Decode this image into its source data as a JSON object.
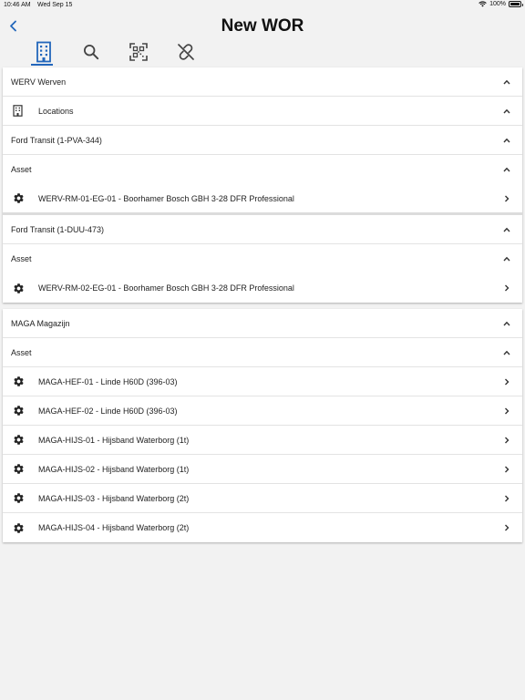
{
  "status": {
    "time": "10:46 AM",
    "date": "Wed Sep 15",
    "battery": "100%"
  },
  "header": {
    "title": "New WOR"
  },
  "toolbar": {
    "tabs": [
      "building-icon",
      "search-icon",
      "qr-scan-icon",
      "unlink-icon"
    ],
    "active_index": 0
  },
  "colors": {
    "accent": "#2266bb",
    "background": "#f2f2f2"
  },
  "sections": [
    {
      "rows": [
        {
          "type": "header",
          "label": "WERV Werven",
          "chevron": "up"
        },
        {
          "type": "item",
          "icon": "building-icon",
          "label": "Locations",
          "chevron": "up"
        },
        {
          "type": "header",
          "label": "Ford Transit (1-PVA-344)",
          "chevron": "up"
        },
        {
          "type": "header",
          "label": "Asset",
          "chevron": "up"
        },
        {
          "type": "item",
          "icon": "gear-icon",
          "label": "WERV-RM-01-EG-01 - Boorhamer Bosch GBH 3-28 DFR Professional",
          "chevron": "right"
        },
        {
          "type": "header",
          "label": "Ford Transit (1-DUU-473)",
          "chevron": "up"
        },
        {
          "type": "header",
          "label": "Asset",
          "chevron": "up"
        },
        {
          "type": "item",
          "icon": "gear-icon",
          "label": "WERV-RM-02-EG-01 - Boorhamer Bosch GBH 3-28 DFR Professional",
          "chevron": "right"
        }
      ]
    },
    {
      "rows": [
        {
          "type": "header",
          "label": "MAGA Magazijn",
          "chevron": "up"
        },
        {
          "type": "header",
          "label": "Asset",
          "chevron": "up"
        },
        {
          "type": "item",
          "icon": "gear-icon",
          "label": "MAGA-HEF-01 - Linde H60D (396-03)",
          "chevron": "right"
        },
        {
          "type": "item",
          "icon": "gear-icon",
          "label": "MAGA-HEF-02 - Linde H60D (396-03)",
          "chevron": "right"
        },
        {
          "type": "item",
          "icon": "gear-icon",
          "label": "MAGA-HIJS-01 - Hijsband Waterborg (1t)",
          "chevron": "right"
        },
        {
          "type": "item",
          "icon": "gear-icon",
          "label": "MAGA-HIJS-02 - Hijsband Waterborg (1t)",
          "chevron": "right"
        },
        {
          "type": "item",
          "icon": "gear-icon",
          "label": "MAGA-HIJS-03 - Hijsband Waterborg (2t)",
          "chevron": "right"
        },
        {
          "type": "item",
          "icon": "gear-icon",
          "label": "MAGA-HIJS-04 - Hijsband Waterborg (2t)",
          "chevron": "right"
        }
      ]
    }
  ]
}
